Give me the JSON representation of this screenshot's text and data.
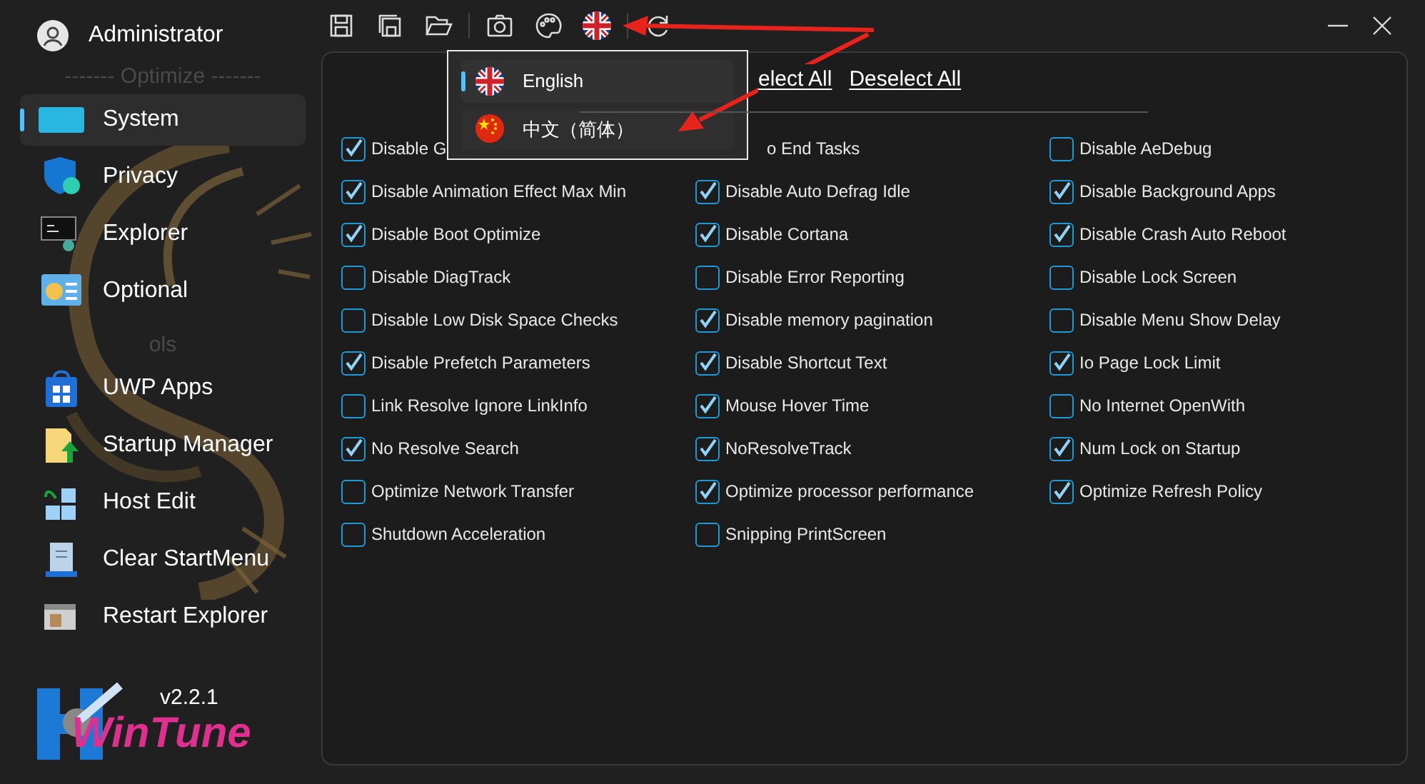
{
  "user": {
    "name": "Administrator"
  },
  "sidebar": {
    "sections": [
      {
        "title": "------- Optimize -------",
        "items": [
          {
            "label": "System",
            "selected": true
          },
          {
            "label": "Privacy",
            "selected": false
          },
          {
            "label": "Explorer",
            "selected": false
          },
          {
            "label": "Optional",
            "selected": false
          }
        ]
      },
      {
        "title": "ols",
        "items": [
          {
            "label": "UWP Apps",
            "selected": false
          },
          {
            "label": "Startup Manager",
            "selected": false
          },
          {
            "label": "Host Edit",
            "selected": false
          },
          {
            "label": "Clear StartMenu",
            "selected": false
          },
          {
            "label": "Restart Explorer",
            "selected": false
          }
        ]
      }
    ]
  },
  "app": {
    "version": "v2.2.1",
    "logo_text": "WinTune"
  },
  "language_menu": [
    {
      "label": "English",
      "selected": true
    },
    {
      "label": "中文（简体）",
      "selected": false
    }
  ],
  "actions": [
    "elect All",
    "Deselect All"
  ],
  "options": [
    {
      "label": "Disable G",
      "checked": true,
      "kind": "full"
    },
    {
      "label": "o End Tasks",
      "kind": "covered"
    },
    {
      "label": "Disable AeDebug",
      "checked": false,
      "kind": "full"
    },
    {
      "label": "Disable Animation Effect Max Min",
      "checked": true,
      "kind": "full"
    },
    {
      "label": "Disable Auto Defrag Idle",
      "checked": true,
      "kind": "full"
    },
    {
      "label": "Disable Background Apps",
      "checked": true,
      "kind": "full"
    },
    {
      "label": "Disable Boot Optimize",
      "checked": true,
      "kind": "full"
    },
    {
      "label": "Disable Cortana",
      "checked": true,
      "kind": "full"
    },
    {
      "label": "Disable Crash Auto Reboot",
      "checked": true,
      "kind": "full"
    },
    {
      "label": "Disable DiagTrack",
      "checked": false,
      "kind": "full"
    },
    {
      "label": "Disable Error Reporting",
      "checked": false,
      "kind": "full"
    },
    {
      "label": "Disable Lock Screen",
      "checked": false,
      "kind": "full"
    },
    {
      "label": "Disable Low Disk Space Checks",
      "checked": false,
      "kind": "full"
    },
    {
      "label": "Disable memory pagination",
      "checked": true,
      "kind": "full"
    },
    {
      "label": "Disable Menu Show Delay",
      "checked": false,
      "kind": "full"
    },
    {
      "label": "Disable Prefetch Parameters",
      "checked": true,
      "kind": "full"
    },
    {
      "label": "Disable Shortcut Text",
      "checked": true,
      "kind": "full"
    },
    {
      "label": "Io Page Lock Limit",
      "checked": true,
      "kind": "full"
    },
    {
      "label": "Link Resolve Ignore LinkInfo",
      "checked": false,
      "kind": "full"
    },
    {
      "label": "Mouse Hover Time",
      "checked": true,
      "kind": "full"
    },
    {
      "label": "No Internet OpenWith",
      "checked": false,
      "kind": "full"
    },
    {
      "label": "No Resolve Search",
      "checked": true,
      "kind": "full"
    },
    {
      "label": "NoResolveTrack",
      "checked": true,
      "kind": "full"
    },
    {
      "label": "Num Lock on Startup",
      "checked": true,
      "kind": "full"
    },
    {
      "label": "Optimize Network Transfer",
      "checked": false,
      "kind": "full"
    },
    {
      "label": "Optimize processor performance",
      "checked": true,
      "kind": "full"
    },
    {
      "label": "Optimize Refresh Policy",
      "checked": true,
      "kind": "full"
    },
    {
      "label": "Shutdown Acceleration",
      "checked": false,
      "kind": "full"
    },
    {
      "label": "Snipping PrintScreen",
      "checked": false,
      "kind": "full"
    }
  ]
}
